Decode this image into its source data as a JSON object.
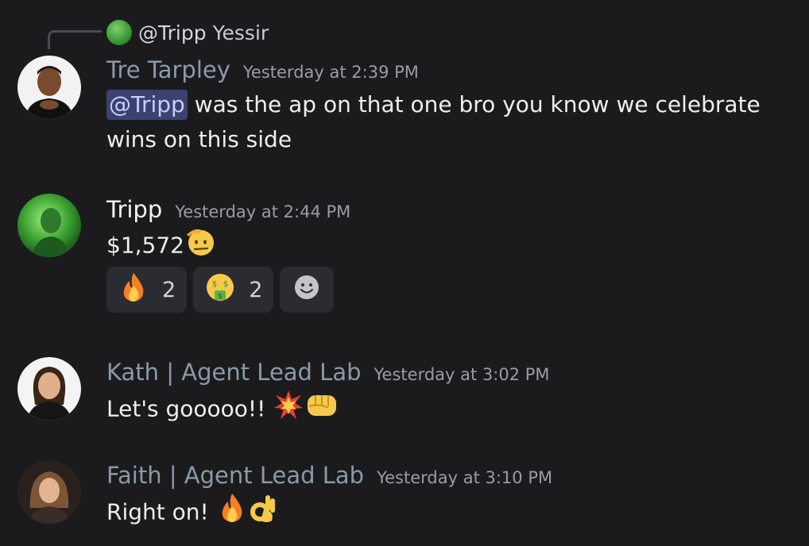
{
  "reply": {
    "author": "@Tripp",
    "text": "Yessir"
  },
  "messages": [
    {
      "author": "Tre Tarpley",
      "timestamp": "Yesterday at 2:39 PM",
      "mention": "@Tripp",
      "line1": " was the ap on that one bro you know we celebrate",
      "line2": "wins on this side"
    },
    {
      "author": "Tripp",
      "timestamp": "Yesterday at 2:44 PM",
      "text": "$1,572",
      "emoji": "saluting-face",
      "reactions": [
        {
          "emoji": "fire",
          "count": "2"
        },
        {
          "emoji": "money-mouth-face",
          "count": "2"
        },
        {
          "emoji": "add-reaction",
          "count": ""
        }
      ]
    },
    {
      "author": "Kath | Agent Lead Lab",
      "timestamp": "Yesterday at 3:02 PM",
      "text": "Let's gooooo!!",
      "emojis": [
        "collision",
        "oncoming-fist"
      ]
    },
    {
      "author": "Faith | Agent Lead Lab",
      "timestamp": "Yesterday at 3:10 PM",
      "text": "Right on!",
      "emojis": [
        "fire",
        "ok-hand"
      ]
    }
  ],
  "colors": {
    "background": "#1b1b1e",
    "author_muted": "#8a9aa6",
    "mention_bg": "#3c4270",
    "reaction_bg": "#2b2c31"
  }
}
